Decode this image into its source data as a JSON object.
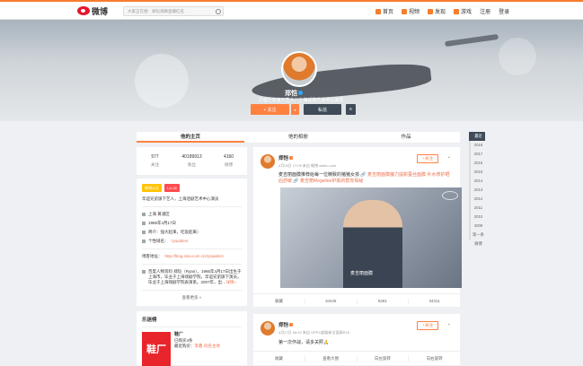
{
  "header": {
    "logo_text": "微博",
    "search_placeholder": "大家正在搜：郑恺海豚直播红名",
    "nav": [
      {
        "label": "首页",
        "icon": "home-icon"
      },
      {
        "label": "视频",
        "icon": "video-icon"
      },
      {
        "label": "发现",
        "icon": "discover-icon"
      },
      {
        "label": "游戏",
        "icon": "game-icon"
      },
      {
        "label": "注册",
        "icon": ""
      },
      {
        "label": "登录",
        "icon": ""
      }
    ]
  },
  "profile": {
    "name": "郑恺",
    "description": "华谊兄弟旗下艺人，上海话剧艺术中心演员",
    "follow_label": "+ 关注",
    "dropdown_label": "▾",
    "message_label": "私信",
    "more_label": "≡"
  },
  "tabs": [
    "他的主页",
    "他的相册",
    "作品"
  ],
  "stats": [
    {
      "value": "577",
      "label": "关注"
    },
    {
      "value": "40189913",
      "label": "粉丝"
    },
    {
      "value": "4160",
      "label": "微博"
    }
  ],
  "info": {
    "badge1": "微博认证",
    "badge2": "LvL45",
    "verified": "华谊兄弟旗下艺人，上海话剧艺术中心演员",
    "location": "上海 黄浦区",
    "birthday": "1986年4月17日",
    "intro": "简介：强大起来，吃饭起来）",
    "domain_label": "个性域名：",
    "domain_link": "zyspiders",
    "blog_label": "博客地址：",
    "blog_link": "http://blog.sina.com.cn/zyspiders",
    "baike": "百度人物资料 郑恺（Ryan），1986年4月17日出生于上海市，毕业于上海戏剧学院，华谊兄弟旗下演员，毕业于上海戏剧学院表演系。2007年，出…",
    "baike_more": "详情»",
    "see_more": "查看更多 »"
  },
  "music": {
    "title": "乐迷榜",
    "poster_text": "鞋厂",
    "song": "鞋厂",
    "plays": "已购买4条",
    "recent_prefix": "最近购买：",
    "recent_link": "李鑫·同名主体"
  },
  "post1": {
    "name": "郑恺",
    "time": "4月26日 17:05 来自 微博 weibo.com",
    "follow_label": "+关注",
    "text": "麦吉丽面膜推荐给每一位精致的猪猪女孩",
    "link1": "麦吉丽面膜",
    "link1b": "魔力提颜蚕丝面膜 补水修护晒后舒缓",
    "link2": "麦吉丽Megeline护肤的帮你揭秘",
    "video_caption": "麦吉丽面膜",
    "actions": [
      "收藏",
      "10445",
      "9281",
      "34311"
    ]
  },
  "post2": {
    "name": "郑恺",
    "time": "4月27日 08:42 来自 OPPO超级新全面屏R15",
    "follow_label": "+关注",
    "text": "第一次作战，请多关照🙏",
    "actions": [
      "收藏",
      "查看大图",
      "向左旋转",
      "向右旋转"
    ]
  },
  "timeline": [
    "最近",
    "2018",
    "2017",
    "2016",
    "2015",
    "2014",
    "2013",
    "2012",
    "2011",
    "2010",
    "2009",
    "第一条微博"
  ]
}
